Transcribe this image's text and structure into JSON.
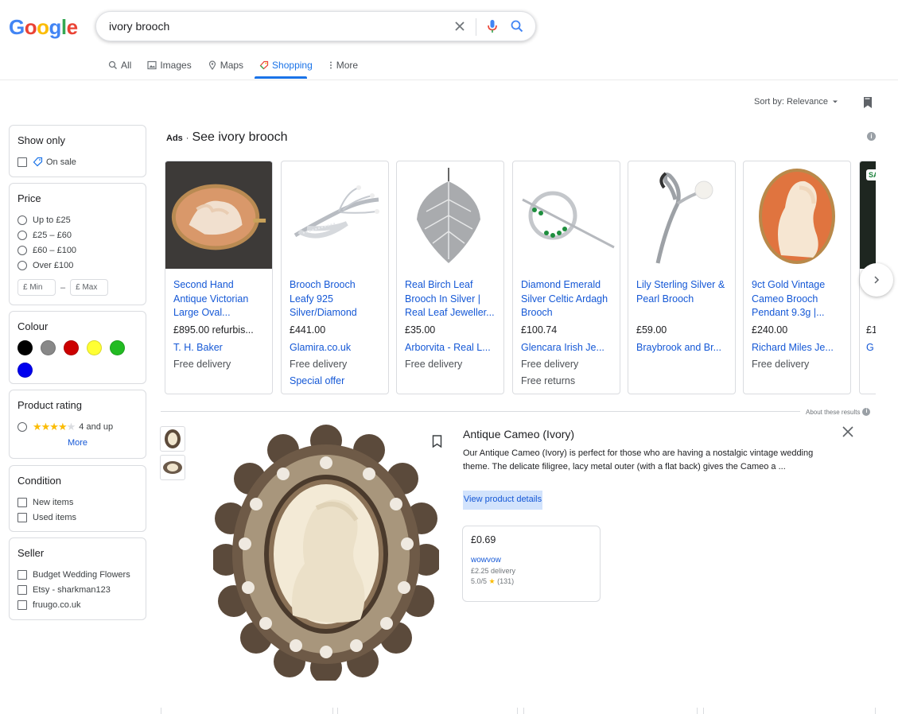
{
  "search": {
    "query": "ivory brooch"
  },
  "logo": {
    "letters": [
      "G",
      "o",
      "o",
      "g",
      "l",
      "e"
    ],
    "colors": [
      "#4285f4",
      "#ea4335",
      "#fbbc05",
      "#4285f4",
      "#34a853",
      "#ea4335"
    ]
  },
  "tabs": [
    {
      "label": "All",
      "icon": "search-icon"
    },
    {
      "label": "Images",
      "icon": "image-icon"
    },
    {
      "label": "Maps",
      "icon": "map-pin-icon"
    },
    {
      "label": "Shopping",
      "icon": "shopping-tag-icon",
      "active": true
    },
    {
      "label": "More",
      "icon": "more-vert-icon"
    }
  ],
  "sort": {
    "label": "Sort by: Relevance"
  },
  "filters": {
    "show_only": {
      "title": "Show only",
      "options": [
        "On sale"
      ]
    },
    "price": {
      "title": "Price",
      "options": [
        "Up to £25",
        "£25 – £60",
        "£60 – £100",
        "Over £100"
      ],
      "min_placeholder": "£ Min",
      "dash": "–",
      "max_placeholder": "£ Max"
    },
    "colour": {
      "title": "Colour",
      "swatches": [
        "#000000",
        "#888888",
        "#cc0000",
        "#ffff33",
        "#22bb22",
        "#0000ee"
      ]
    },
    "rating": {
      "title": "Product rating",
      "label": "4 and up",
      "stars": 4,
      "more": "More"
    },
    "condition": {
      "title": "Condition",
      "options": [
        "New items",
        "Used items"
      ]
    },
    "seller": {
      "title": "Seller",
      "options": [
        "Budget Wedding Flowers",
        "Etsy - sharkman123",
        "fruugo.co.uk"
      ]
    }
  },
  "ads": {
    "tag": "Ads",
    "dot": "·",
    "heading": "See ivory brooch",
    "cards": [
      {
        "title": "Second Hand Antique Victorian Large Oval...",
        "price": "£895.00 refurbis...",
        "merchant": "T. H. Baker",
        "delivery": "Free delivery",
        "extra": ""
      },
      {
        "title": "Brooch Brooch Leafy 925 Silver/Diamond",
        "price": "£441.00",
        "merchant": "Glamira.co.uk",
        "delivery": "Free delivery",
        "extra": "Special offer"
      },
      {
        "title": "Real Birch Leaf Brooch In Silver | Real Leaf Jeweller...",
        "price": "£35.00",
        "merchant": "Arborvita - Real L...",
        "delivery": "Free delivery",
        "extra": ""
      },
      {
        "title": "Diamond Emerald Silver Celtic Ardagh Brooch",
        "price": "£100.74",
        "merchant": "Glencara Irish Je...",
        "delivery": "Free delivery",
        "extra": "Free returns"
      },
      {
        "title": "Lily Sterling Silver & Pearl Brooch",
        "price": "£59.00",
        "merchant": "Braybrook and Br...",
        "delivery": "",
        "extra": ""
      },
      {
        "title": "9ct Gold Vintage Cameo Brooch Pendant 9.3g |...",
        "price": "£240.00",
        "merchant": "Richard Miles Je...",
        "delivery": "Free delivery",
        "extra": ""
      },
      {
        "title": "Ri",
        "price": "£1",
        "merchant": "G",
        "delivery": "",
        "extra": "",
        "badge": "SA"
      }
    ]
  },
  "about": "About these results",
  "product": {
    "title": "Antique Cameo (Ivory)",
    "description": "Our Antique Cameo (Ivory) is perfect for those who are having a nostalgic vintage wedding theme. The delicate filigree, lacy metal outer (with a flat back) gives the Cameo a ...",
    "view_details": "View product details",
    "offer": {
      "price": "£0.69",
      "seller": "wowvow",
      "delivery": "£2.25 delivery",
      "rating": "5.0/5",
      "star": "★",
      "reviews": "(131)"
    }
  }
}
